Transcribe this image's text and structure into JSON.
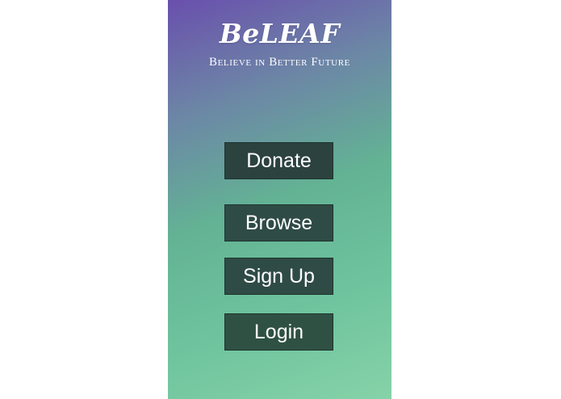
{
  "app": {
    "title": "BeLEAF",
    "tagline": "Believe in Better Future"
  },
  "menu": {
    "donate_label": "Donate",
    "browse_label": "Browse",
    "signup_label": "Sign Up",
    "login_label": "Login"
  },
  "colors": {
    "gradient_top": "#6a4fad",
    "gradient_bottom": "#86d2a8",
    "button_bg": "#2f4b45"
  }
}
